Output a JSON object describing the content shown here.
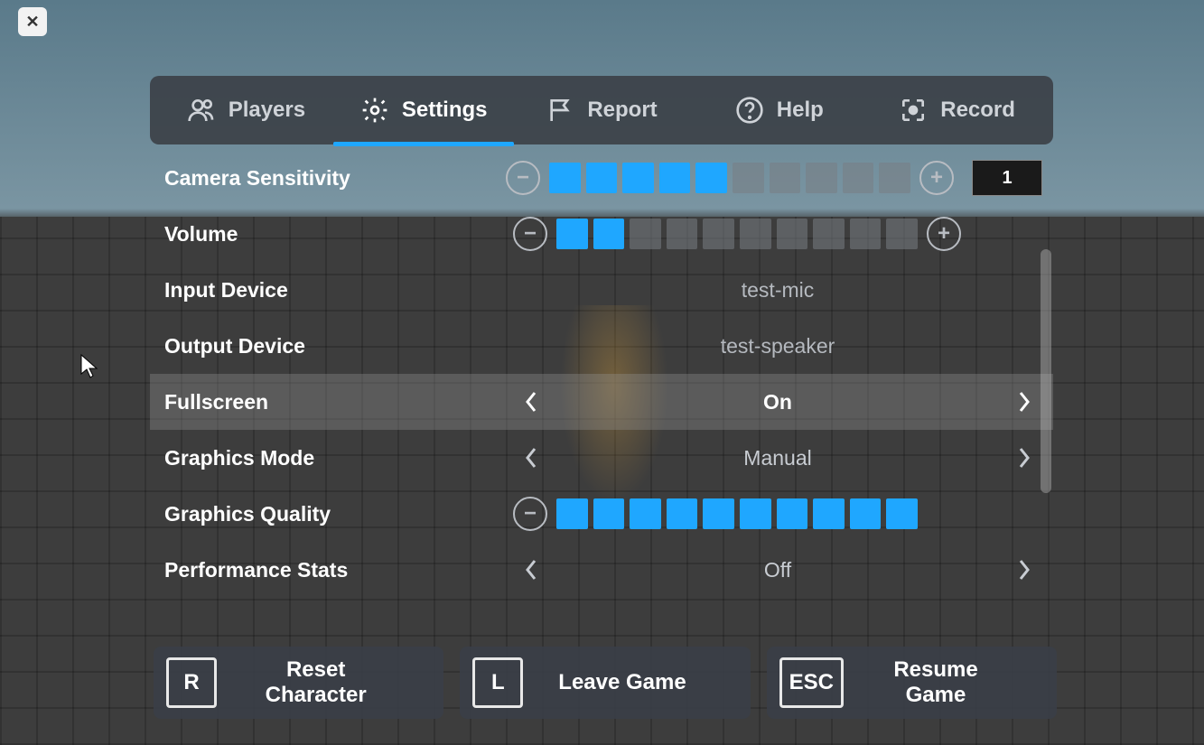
{
  "close_label": "✕",
  "tabs": {
    "players": "Players",
    "settings": "Settings",
    "report": "Report",
    "help": "Help",
    "record": "Record",
    "active": "settings"
  },
  "settings": {
    "camera_sensitivity": {
      "label": "Camera Sensitivity",
      "filled": 5,
      "total": 10,
      "value": "1"
    },
    "volume": {
      "label": "Volume",
      "filled": 2,
      "total": 10
    },
    "input_device": {
      "label": "Input Device",
      "value": "test-mic"
    },
    "output_device": {
      "label": "Output Device",
      "value": "test-speaker"
    },
    "fullscreen": {
      "label": "Fullscreen",
      "value": "On"
    },
    "graphics_mode": {
      "label": "Graphics Mode",
      "value": "Manual"
    },
    "graphics_quality": {
      "label": "Graphics Quality",
      "filled": 10,
      "total": 10
    },
    "performance_stats": {
      "label": "Performance Stats",
      "value": "Off"
    }
  },
  "footer": {
    "reset": {
      "key": "R",
      "label": "Reset Character"
    },
    "leave": {
      "key": "L",
      "label": "Leave Game"
    },
    "resume": {
      "key": "ESC",
      "label": "Resume Game"
    }
  }
}
